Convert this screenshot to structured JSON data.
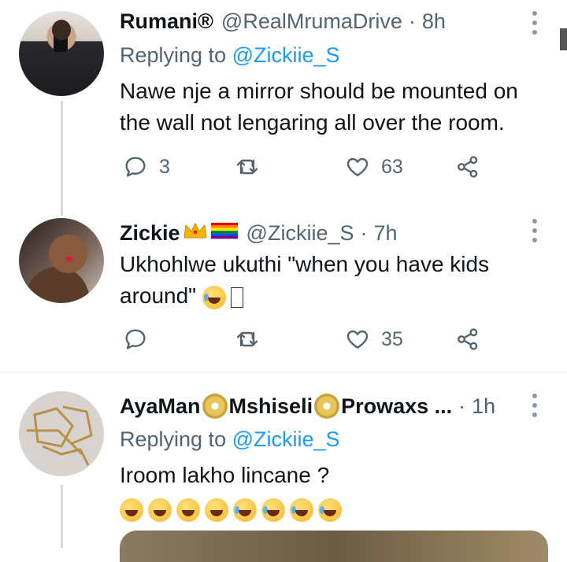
{
  "tweets": [
    {
      "name": "Rumani®",
      "handle": "@RealMrumaDrive",
      "time": "8h",
      "replying_prefix": "Replying to ",
      "replying_to": "@Zickiie_S",
      "text_lines": [
        "Nawe nje a mirror should be mounted on",
        "the wall not lengaring all over the room."
      ],
      "replies": "3",
      "retweets": "",
      "likes": "63"
    },
    {
      "name": "Zickie",
      "handle": "@Zickiie_S",
      "time": "7h",
      "text_lines": [
        "Ukhohlwe ukuthi \"when you have kids",
        "around\""
      ],
      "replies": "",
      "retweets": "",
      "likes": "35"
    },
    {
      "name_parts": [
        "AyaMan",
        "Mshiseli",
        "Prowaxs ..."
      ],
      "time": "1h",
      "replying_prefix": "Replying to ",
      "replying_to": "@Zickiie_S",
      "text_lines": [
        "Iroom lakho lincane ?"
      ]
    }
  ],
  "separator": "·",
  "icons": {
    "reply": "reply-icon",
    "retweet": "retweet-icon",
    "like": "heart-icon",
    "share": "share-icon",
    "more": "more-vertical-icon"
  },
  "colors": {
    "mention": "#1d9bf0",
    "secondary_text": "#536471"
  }
}
